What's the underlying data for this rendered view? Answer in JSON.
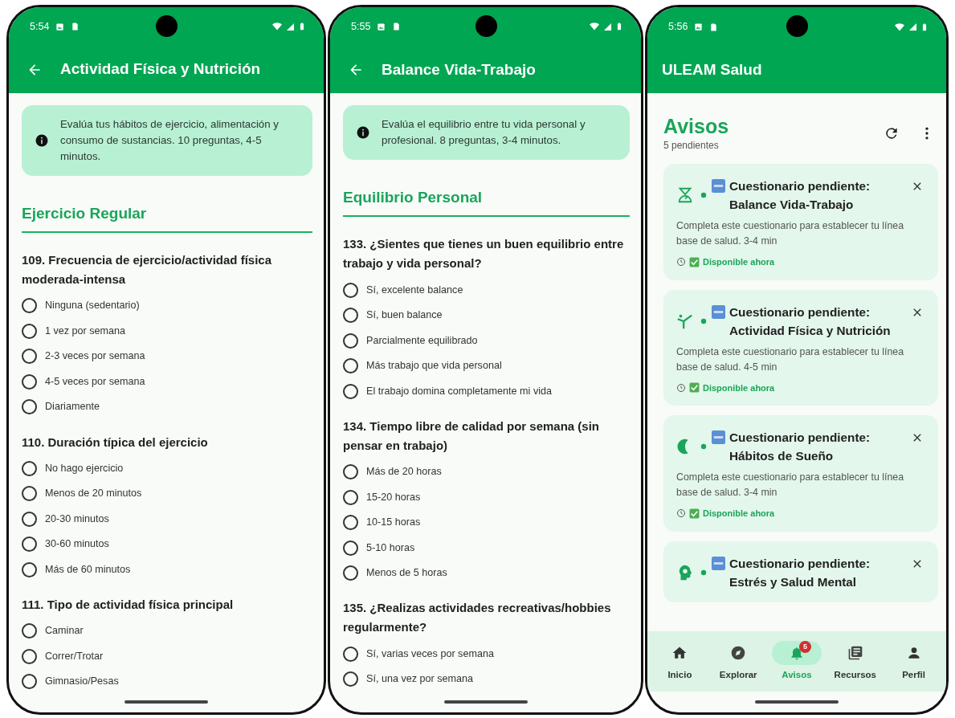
{
  "phones": [
    {
      "kind": "questionnaire",
      "status_time": "5:54",
      "title": "Actividad Física y Nutrición",
      "info": "Evalúa tus hábitos de ejercicio, alimentación y consumo de sustancias. 10 preguntas, 4-5 minutos.",
      "section": "Ejercicio Regular",
      "questions": [
        {
          "text": "109. Frecuencia de ejercicio/actividad física moderada-intensa",
          "options": [
            {
              "label": "Ninguna (sedentario)",
              "selected": false
            },
            {
              "label": "1 vez por semana",
              "selected": false
            },
            {
              "label": "2-3 veces por semana",
              "selected": false
            },
            {
              "label": "4-5 veces por semana",
              "selected": false
            },
            {
              "label": "Diariamente",
              "selected": false
            }
          ]
        },
        {
          "text": "110. Duración típica del ejercicio",
          "options": [
            {
              "label": "No hago ejercicio",
              "selected": false
            },
            {
              "label": "Menos de 20 minutos",
              "selected": false
            },
            {
              "label": "20-30 minutos",
              "selected": false
            },
            {
              "label": "30-60 minutos",
              "selected": false
            },
            {
              "label": "Más de 60 minutos",
              "selected": false
            }
          ]
        },
        {
          "text": "111. Tipo de actividad física principal",
          "options": [
            {
              "label": "Caminar",
              "selected": false
            },
            {
              "label": "Correr/Trotar",
              "selected": false
            },
            {
              "label": "Gimnasio/Pesas",
              "selected": false
            }
          ]
        }
      ]
    },
    {
      "kind": "questionnaire",
      "status_time": "5:55",
      "title": "Balance Vida-Trabajo",
      "info": "Evalúa el equilibrio entre tu vida personal y profesional. 8 preguntas, 3-4 minutos.",
      "section": "Equilibrio Personal",
      "questions": [
        {
          "text": "133. ¿Sientes que tienes un buen equilibrio entre trabajo y vida personal?",
          "options": [
            {
              "label": "Sí, excelente balance",
              "selected": false
            },
            {
              "label": "Sí, buen balance",
              "selected": false
            },
            {
              "label": "Parcialmente equilibrado",
              "selected": false
            },
            {
              "label": "Más trabajo que vida personal",
              "selected": false
            },
            {
              "label": "El trabajo domina completamente mi vida",
              "selected": false
            }
          ]
        },
        {
          "text": "134. Tiempo libre de calidad por semana (sin pensar en trabajo)",
          "options": [
            {
              "label": "Más de 20 horas",
              "selected": false
            },
            {
              "label": "15-20 horas",
              "selected": false
            },
            {
              "label": "10-15 horas",
              "selected": false
            },
            {
              "label": "5-10 horas",
              "selected": false
            },
            {
              "label": "Menos de 5 horas",
              "selected": false
            }
          ]
        },
        {
          "text": "135. ¿Realizas actividades recreativas/hobbies regularmente?",
          "options": [
            {
              "label": "Sí, varias veces por semana",
              "selected": false
            },
            {
              "label": "Sí, una vez por semana",
              "selected": false
            }
          ]
        }
      ]
    },
    {
      "kind": "notifications",
      "status_time": "5:56",
      "title": "ULEAM Salud",
      "heading": "Avisos",
      "subtitle": "5 pendientes",
      "cards": [
        {
          "kind": "balance",
          "title": "Cuestionario pendiente: Balance Vida-Trabajo",
          "description": "Completa este cuestionario para establecer tu línea base de salud. 3-4 min",
          "availability": "Disponible ahora"
        },
        {
          "kind": "activity",
          "title": "Cuestionario pendiente: Actividad Física y Nutrición",
          "description": "Completa este cuestionario para establecer tu línea base de salud. 4-5 min",
          "availability": "Disponible ahora"
        },
        {
          "kind": "sleep",
          "title": "Cuestionario pendiente: Hábitos de Sueño",
          "description": "Completa este cuestionario para establecer tu línea base de salud. 3-4 min",
          "availability": "Disponible ahora"
        },
        {
          "kind": "mind",
          "title": "Cuestionario pendiente: Estrés y Salud Mental"
        }
      ],
      "nav": [
        {
          "kind": "home",
          "label": "Inicio",
          "selected": false
        },
        {
          "kind": "explore",
          "label": "Explorar",
          "selected": false
        },
        {
          "kind": "alerts",
          "label": "Avisos",
          "selected": true,
          "badge": "5"
        },
        {
          "kind": "resources",
          "label": "Recursos",
          "selected": false
        },
        {
          "kind": "profile",
          "label": "Perfil",
          "selected": false
        }
      ]
    }
  ]
}
